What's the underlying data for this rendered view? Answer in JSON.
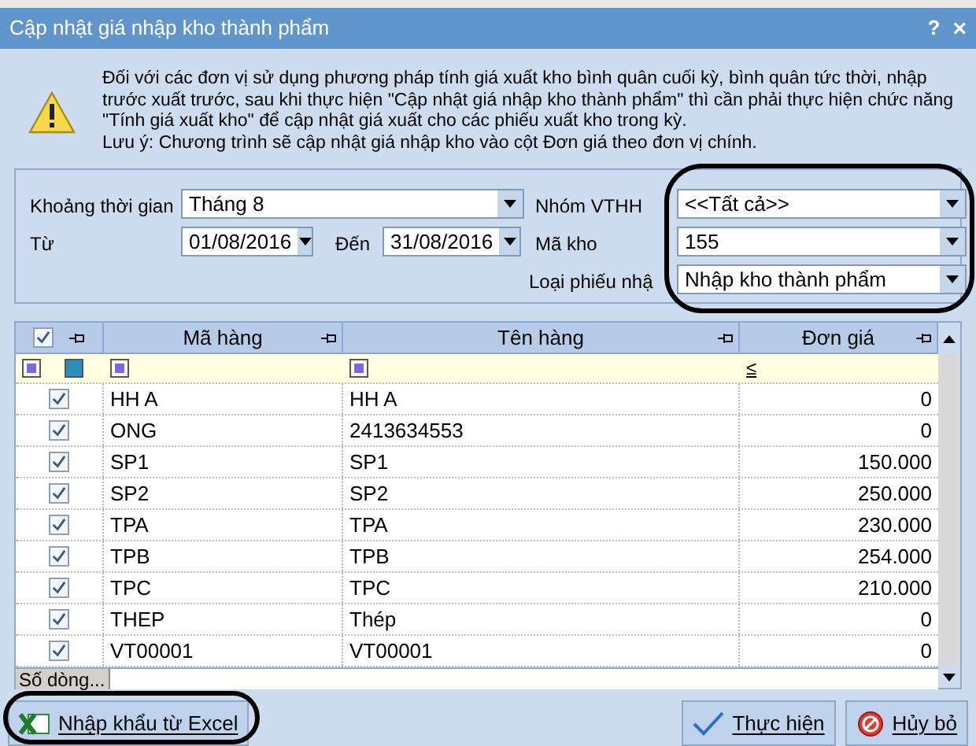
{
  "window": {
    "title": "Cập nhật giá nhập kho thành phẩm",
    "help": "?",
    "close": "×"
  },
  "notice": {
    "text": "Đối với các đơn vị sử dụng phương pháp tính giá xuất kho bình quân cuối kỳ, bình quân tức thời, nhập trước xuất trước, sau khi thực hiện \"Cập nhật giá nhập kho thành phẩm\" thì cần phải thực hiện chức năng \"Tính giá xuất kho\" để cập nhật giá xuất cho các phiếu xuất kho trong kỳ.",
    "note": "Lưu ý: Chương trình sẽ cập nhật giá nhập kho vào cột Đơn giá theo đơn vị chính."
  },
  "filters": {
    "period": {
      "label": "Khoảng thời gian",
      "value": "Tháng 8"
    },
    "from": {
      "label": "Từ",
      "value": "01/08/2016"
    },
    "to": {
      "label": "Đến",
      "value": "31/08/2016"
    },
    "group": {
      "label": "Nhóm VTHH",
      "value": "<<Tất cả>>"
    },
    "warehouse": {
      "label": "Mã kho",
      "value": "155"
    },
    "receipt_type": {
      "label": "Loại phiếu nhậ",
      "value": "Nhập kho thành phẩm"
    }
  },
  "table": {
    "columns": [
      "Mã hàng",
      "Tên hàng",
      "Đơn giá"
    ],
    "header_checked": true,
    "filter_operator": "≤",
    "rows": [
      {
        "checked": true,
        "code": "HH A",
        "name": "HH A",
        "price": "0"
      },
      {
        "checked": true,
        "code": "ONG",
        "name": "2413634553",
        "price": "0"
      },
      {
        "checked": true,
        "code": "SP1",
        "name": "SP1",
        "price": "150.000"
      },
      {
        "checked": true,
        "code": "SP2",
        "name": "SP2",
        "price": "250.000"
      },
      {
        "checked": true,
        "code": "TPA",
        "name": "TPA",
        "price": "230.000"
      },
      {
        "checked": true,
        "code": "TPB",
        "name": "TPB",
        "price": "254.000"
      },
      {
        "checked": true,
        "code": "TPC",
        "name": "TPC",
        "price": "210.000"
      },
      {
        "checked": true,
        "code": "THEP",
        "name": "Thép",
        "price": "0"
      },
      {
        "checked": true,
        "code": "VT00001",
        "name": "VT00001",
        "price": "0"
      }
    ],
    "footer": "Số dòng..."
  },
  "buttons": {
    "import": "Nhập khẩu từ Excel",
    "ok": "Thực hiện",
    "cancel": "Hủy bỏ"
  }
}
